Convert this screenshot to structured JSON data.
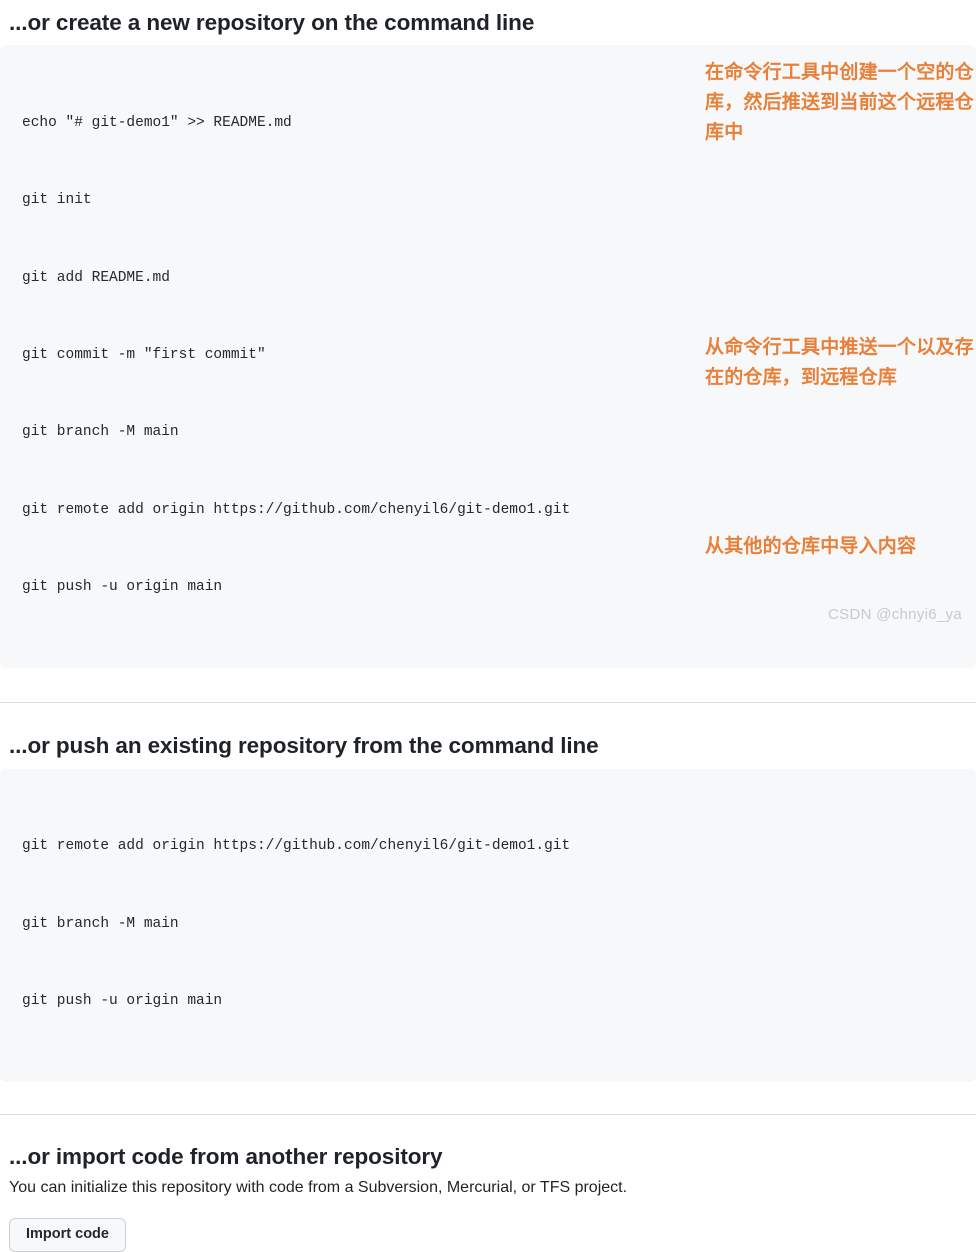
{
  "sections": {
    "create": {
      "heading": "...or create a new repository on the command line",
      "code_lines": [
        "echo \"# git-demo1\" >> README.md",
        "git init",
        "git add README.md",
        "git commit -m \"first commit\"",
        "git branch -M main",
        "git remote add origin https://github.com/chenyil6/git-demo1.git",
        "git push -u origin main"
      ],
      "annotation": "在命令行工具中创建一个空的仓库，然后推送到当前这个远程仓库中"
    },
    "push": {
      "heading": "...or push an existing repository from the command line",
      "code_lines": [
        "git remote add origin https://github.com/chenyil6/git-demo1.git",
        "git branch -M main",
        "git push -u origin main"
      ],
      "annotation": "从命令行工具中推送一个以及存在的仓库，到远程仓库"
    },
    "import": {
      "heading": "...or import code from another repository",
      "description": "You can initialize this repository with code from a Subversion, Mercurial, or TFS project.",
      "button_label": "Import code",
      "annotation": "从其他的仓库中导入内容"
    }
  },
  "watermark": "CSDN @chnyi6_ya",
  "colors": {
    "annotation": "#e8803a",
    "code_background": "#f6f8fa",
    "divider": "#d8dee4",
    "heading": "#1f2328",
    "button_background": "#f6f8fa"
  }
}
